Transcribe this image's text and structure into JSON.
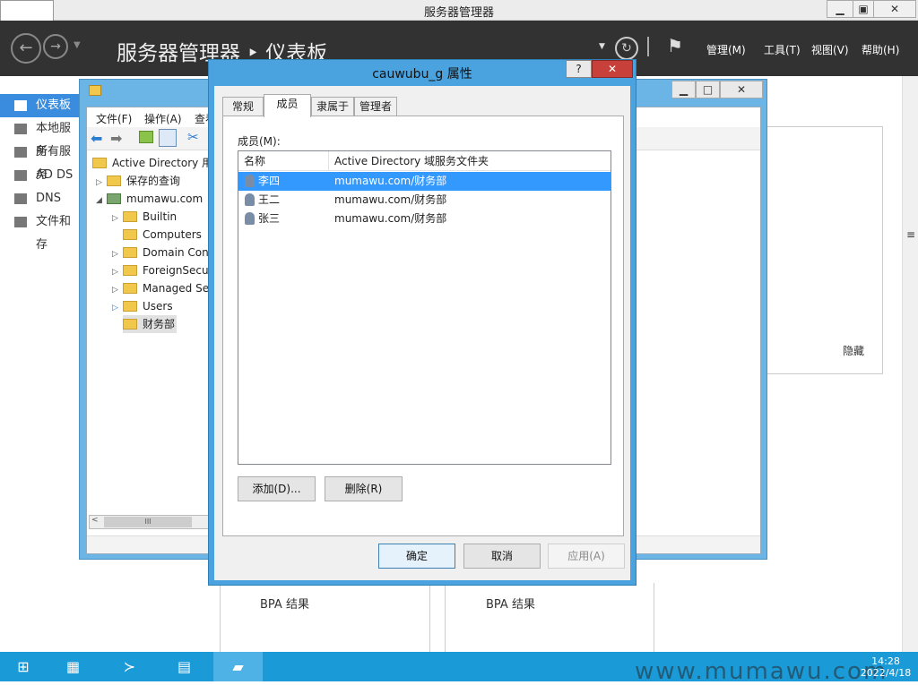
{
  "server_manager": {
    "window_title": "服务器管理器",
    "breadcrumb": "服务器管理器 ‣ 仪表板",
    "menus": [
      "管理(M)",
      "工具(T)",
      "视图(V)",
      "帮助(H)"
    ],
    "nav": [
      {
        "label": "仪表板",
        "icon": "dashboard-icon",
        "active": true
      },
      {
        "label": "本地服务",
        "icon": "local-server-icon"
      },
      {
        "label": "所有服务",
        "icon": "all-servers-icon"
      },
      {
        "label": "AD DS",
        "icon": "ad-ds-icon"
      },
      {
        "label": "DNS",
        "icon": "dns-icon"
      },
      {
        "label": "文件和存",
        "icon": "file-storage-icon"
      }
    ],
    "hide_label": "隐藏",
    "bpa": [
      "BPA 结果",
      "BPA 结果"
    ]
  },
  "aduc": {
    "menus": [
      "文件(F)",
      "操作(A)",
      "查看"
    ],
    "tree": {
      "root": "Active Directory 用户",
      "saved_queries": "保存的查询",
      "domain": "mumawu.com",
      "children": [
        "Builtin",
        "Computers",
        "Domain Con",
        "ForeignSecu",
        "Managed Se",
        "Users",
        "财务部"
      ]
    },
    "scroll_thumb": "III"
  },
  "dialog": {
    "title": "cauwubu_g 属性",
    "help": "?",
    "close": "✕",
    "tabs": [
      "常规",
      "成员",
      "隶属于",
      "管理者"
    ],
    "active_tab": "成员",
    "members_label": "成员(M):",
    "columns": [
      "名称",
      "Active Directory 域服务文件夹"
    ],
    "rows": [
      {
        "name": "李四",
        "folder": "mumawu.com/财务部",
        "selected": true
      },
      {
        "name": "王二",
        "folder": "mumawu.com/财务部"
      },
      {
        "name": "张三",
        "folder": "mumawu.com/财务部"
      }
    ],
    "add_button": "添加(D)...",
    "remove_button": "删除(R)",
    "ok_button": "确定",
    "cancel_button": "取消",
    "apply_button": "应用(A)"
  },
  "taskbar": {
    "time": "14:28",
    "date": "2022/4/18"
  },
  "watermark": "www.mumawu.com"
}
